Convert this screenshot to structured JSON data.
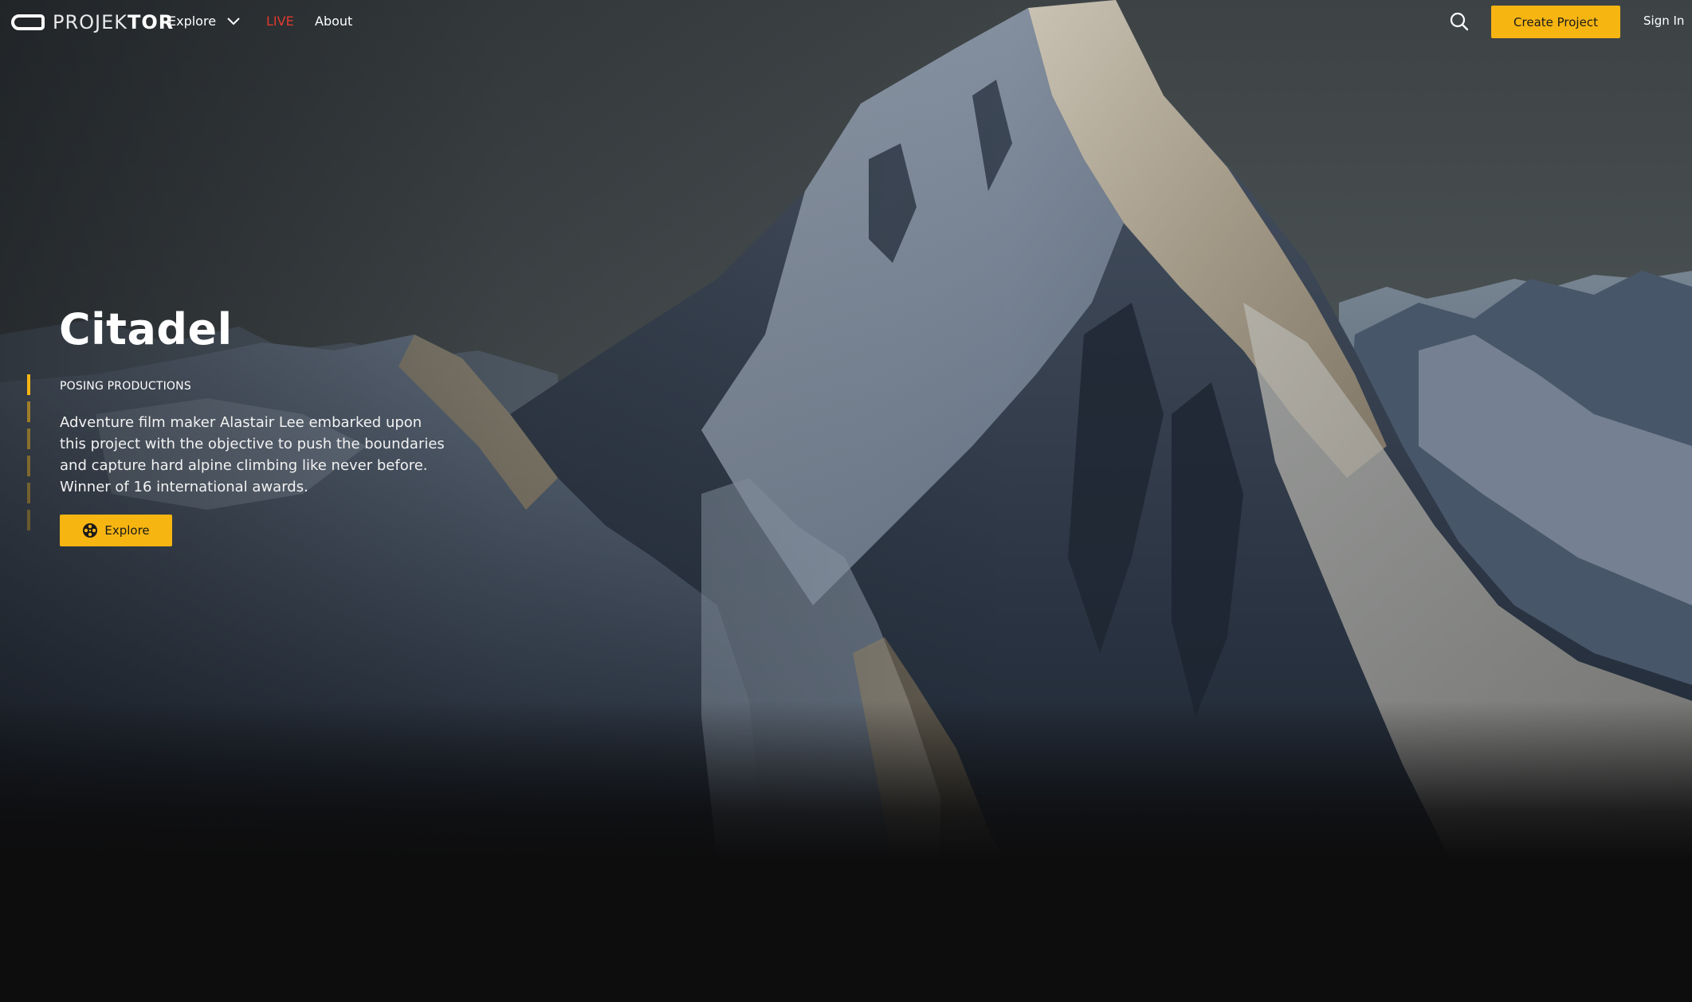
{
  "brand": {
    "logo_text_light": "PROJEK",
    "logo_text_bold": "TOR",
    "accent_color": "#f7b512",
    "live_color": "#e03a2f"
  },
  "nav": {
    "explore_label": "Explore",
    "live_label": "LIVE",
    "about_label": "About",
    "search_icon": "search-icon",
    "create_project_label": "Create Project",
    "sign_in_label": "Sign In"
  },
  "hero": {
    "title": "Citadel",
    "producer": "POSING PRODUCTIONS",
    "description": "Adventure film maker Alastair Lee embarked upon this project with the objective to push the boundaries and capture hard alpine climbing like never before. Winner of 16 international awards.",
    "explore_button_label": "Explore",
    "explore_button_icon": "film-reel-icon",
    "background_image": "snow-capped mountain peak"
  }
}
